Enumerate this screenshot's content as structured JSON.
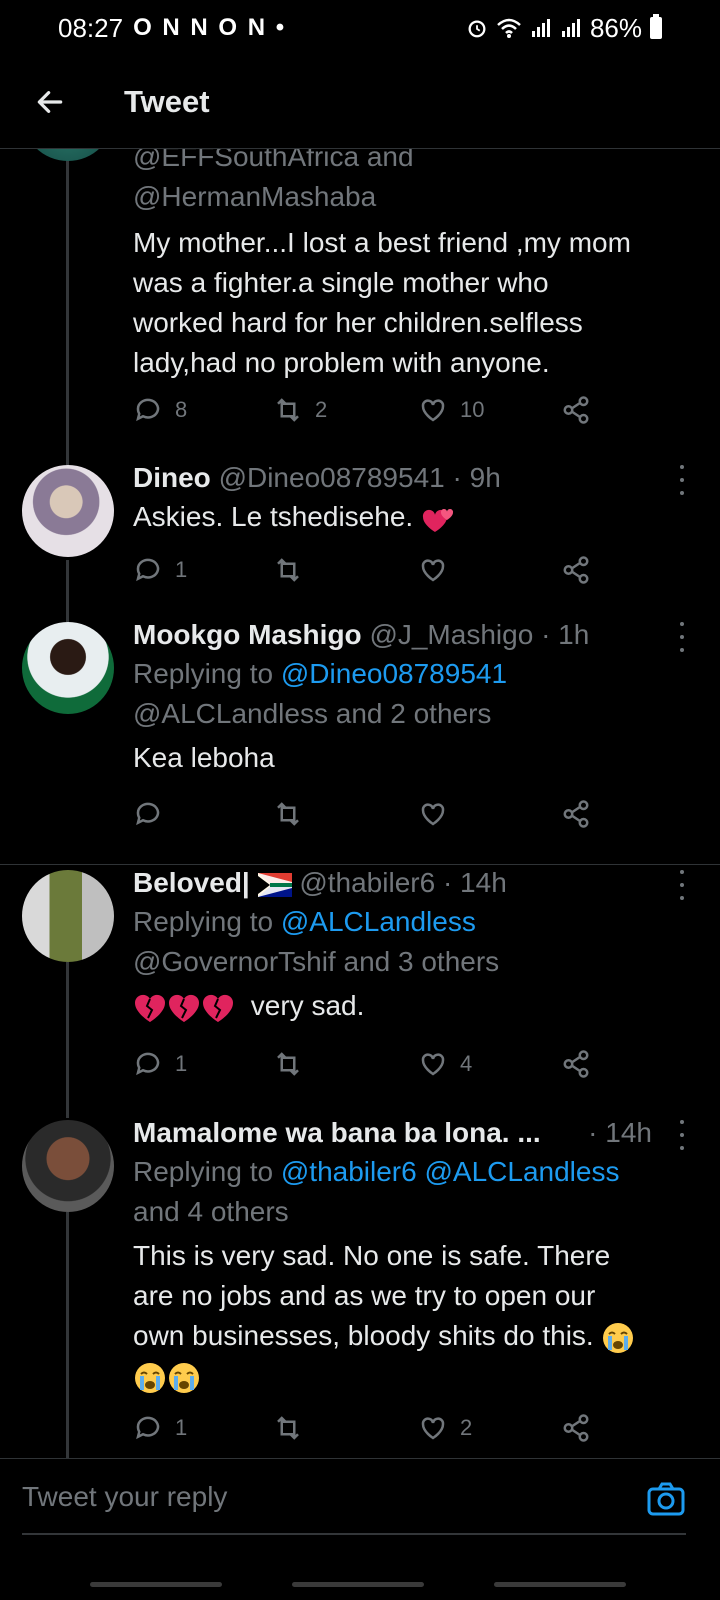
{
  "status": {
    "time": "08:27",
    "indicators": "O N N O N •",
    "battery": "86%"
  },
  "header": {
    "title": "Tweet"
  },
  "tweets": [
    {
      "reply_line_1": "@EFFSouthAfrica and",
      "reply_line_2": "@HermanMashaba",
      "text_lines": [
        "My mother...I lost a best friend ,my mom",
        "was a fighter.a single mother who",
        "worked hard for her children.selfless",
        "lady,had no problem with anyone."
      ],
      "replies": "8",
      "retweets": "2",
      "likes": "10"
    },
    {
      "name": "Dineo",
      "handle": "@Dineo08789541",
      "time": "· 9h",
      "text": "Askies. Le tshedisehe.",
      "replies": "1",
      "retweets": "",
      "likes": ""
    },
    {
      "name": "Mookgo Mashigo",
      "handle": "@J_Mashigo",
      "time": "· 1h",
      "replying_prefix": "Replying to",
      "replying_to_1": "@Dineo08789541",
      "replying_to_2": "@ALCLandless and 2 others",
      "text": "Kea leboha",
      "replies": "",
      "retweets": "",
      "likes": ""
    },
    {
      "name": "Beloved|",
      "handle": "@thabiler6",
      "time": "· 14h",
      "replying_prefix": "Replying to",
      "replying_to_1": "@ALCLandless",
      "replying_to_2": "@GovernorTshif and 3 others",
      "text": "very sad.",
      "replies": "1",
      "retweets": "",
      "likes": "4"
    },
    {
      "name": "Mamalome wa bana ba lona. ...",
      "handle": "",
      "time": "· 14h",
      "replying_prefix": "Replying to",
      "replying_to_1": "@thabiler6 @ALCLandless",
      "replying_to_2": "and 4 others",
      "text_lines": [
        "This is very sad. No one is safe. There",
        "are no jobs and as we try to open our",
        "own businesses, bloody shits do this."
      ],
      "replies": "1",
      "retweets": "",
      "likes": "2"
    }
  ],
  "reply_bar": {
    "placeholder": "Tweet your reply"
  },
  "colors": {
    "background": "#000000",
    "link": "#1d9bf0",
    "muted": "#71767b",
    "text": "#e7e9ea"
  }
}
